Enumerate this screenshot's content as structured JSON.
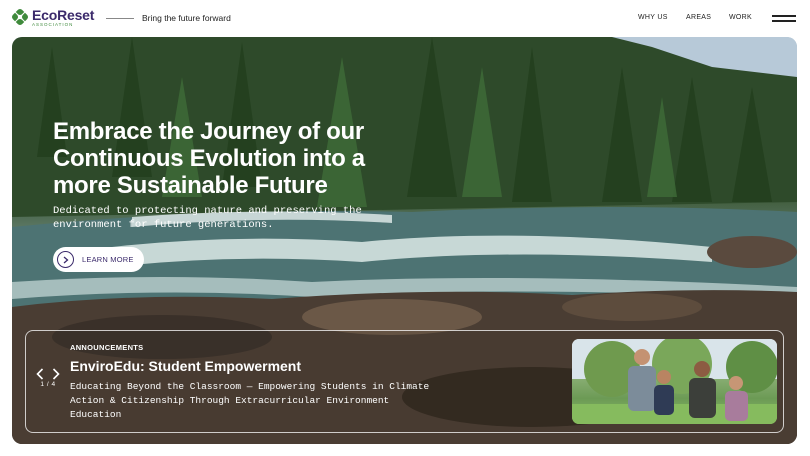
{
  "header": {
    "logo_name": "EcoReset",
    "logo_sub": "ASSOCIATION",
    "tagline": "Bring the future forward",
    "nav": [
      "WHY US",
      "AREAS",
      "WORK"
    ]
  },
  "hero": {
    "title": "Embrace the Journey of our Continuous Evolution into a more Sustainable Future",
    "description": "Dedicated to protecting nature and preserving the environment for future generations.",
    "cta_label": "LEARN MORE"
  },
  "announcement": {
    "kicker": "ANNOUNCEMENTS",
    "counter": "1 / 4",
    "title": "EnviroEdu: Student Empowerment",
    "description": "Educating Beyond the Classroom — Empowering Students in Climate Action & Citizenship Through Extracurricular Environment Education"
  },
  "colors": {
    "brand_purple": "#3b2a6b",
    "brand_green": "#3f8a3c"
  },
  "icons": {
    "logo": "leaf-cluster-icon",
    "menu": "hamburger-menu-icon",
    "cta": "chevron-right-icon",
    "prev": "chevron-left-icon",
    "next": "chevron-right-icon"
  }
}
